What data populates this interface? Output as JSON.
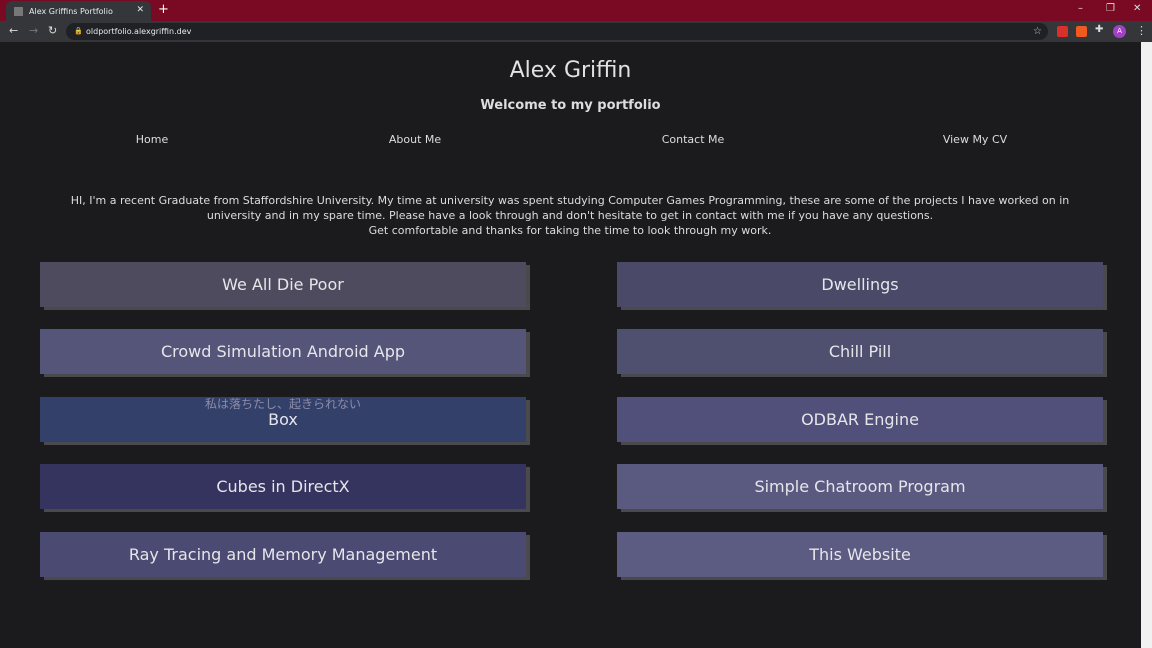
{
  "browser": {
    "tab_title": "Alex Griffins Portfolio",
    "url": "oldportfolio.alexgriffin.dev",
    "avatar_letter": "A",
    "frame_color": "#7a0a24"
  },
  "header": {
    "title": "Alex Griffin",
    "subtitle": "Welcome to my portfolio"
  },
  "nav": [
    "Home",
    "About Me",
    "Contact Me",
    "View My CV"
  ],
  "intro": [
    "HI, I'm a recent Graduate from Staffordshire University. My time at university was spent studying Computer Games Programming, these are some of the projects I have worked on in university and in my spare time. Please have a look through and don't hesitate to get in contact with me if you have any questions.",
    "Get comfortable and thanks for taking the time to look through my work."
  ],
  "projects": [
    {
      "label": "We All Die Poor",
      "color": "#4f4b5e"
    },
    {
      "label": "Dwellings",
      "color": "#4a4a68"
    },
    {
      "label": "Crowd Simulation Android App",
      "color": "#55557a"
    },
    {
      "label": "Chill Pill",
      "color": "#4f4f70"
    },
    {
      "label": "Box",
      "color": "#33406a",
      "overlay_text": "私は落ちたし、起きられない"
    },
    {
      "label": "ODBAR Engine",
      "color": "#50507a"
    },
    {
      "label": "Cubes in DirectX",
      "color": "#34345e"
    },
    {
      "label": "Simple Chatroom Program",
      "color": "#5a5a80"
    },
    {
      "label": "Ray Tracing and Memory Management",
      "color": "#4a4a72"
    },
    {
      "label": "This Website",
      "color": "#5c5c82"
    }
  ]
}
